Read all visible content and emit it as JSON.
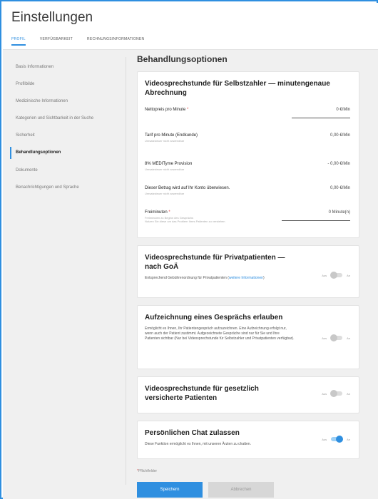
{
  "header": {
    "title": "Einstellungen",
    "tabs": [
      "PROFIL",
      "VERFÜGBARKEIT",
      "RECHNUNGSINFORMATIONEN"
    ]
  },
  "sidebar": {
    "items": [
      "Basis Informationen",
      "Profilbilde",
      "Medizinische Informationen",
      "Kategorien und Sichtbarkeit in der Suche",
      "Sicherheit",
      "Behandlungsoptionen",
      "Dokumente",
      "Benachrichtigungen und Sprache"
    ],
    "active_index": 5
  },
  "main": {
    "page_title": "Behandlungsoptionen",
    "selfpay": {
      "title": "Videosprechstunde für Selbstzahler — minutengenaue Abrechnung",
      "net_label": "Nettopreis pro Minute",
      "net_required": "*",
      "net_value": "0 €/Min",
      "tariff_label": "Tarif pro Minute (Endkunde)",
      "tariff_sub": "Umsatzsteuer nicht anwendbar",
      "tariff_value": "0,00 €/Min",
      "commission_label": "8% MEDITyme Provision",
      "commission_sub": "Umsatzsteuer nicht anwendbar",
      "commission_value": "- 0,00 €/Min",
      "payout_label": "Dieser Betrag wird auf Ihr Konto überwiesen.",
      "payout_sub": "Umsatzsteuer nicht anwendbar",
      "payout_value": "0,00 €/Min",
      "free_label": "Freiminuten",
      "free_required": "*",
      "free_sub1": "Freiminuten zu Beginn des Gesprächs",
      "free_sub2": "Nutzen Sie diese um das Problem Ihres Patienten zu verstehen",
      "free_value": "0 Minute(n)"
    },
    "private": {
      "title": "Videosprechstunde für Privatpatienten — nach GoÄ",
      "desc": "Entsprechend Gebührenordnung für Privatpatienten (",
      "link": "weitere Informationen",
      "desc_end": ")",
      "off": "Aus",
      "on": "An",
      "enabled": false
    },
    "recording": {
      "title": "Aufzeichnung eines Gesprächs erlauben",
      "desc": "Ermöglicht es Ihnen, Ihr Patientengespräch aufzuzeichnen. Eine Aufzeichnung erfolgt nur, wenn auch der Patient zustimmt. Aufgezeichnete Gespräche sind nur für Sie und Ihre Patienten sichtbar (Nur bei Videosprechstunde für Selbstzahler und Privatpatienten verfügbar).",
      "off": "Aus",
      "on": "An",
      "enabled": false
    },
    "statutory": {
      "title": "Videosprechstunde für gesetzlich versicherte Patienten",
      "off": "Aus",
      "on": "An",
      "enabled": false
    },
    "chat": {
      "title": "Persönlichen Chat zulassen",
      "desc": "Diese Funktion ermöglicht es Ihnen, mit unseren Ärzten zu chatten.",
      "off": "Aus",
      "on": "An",
      "enabled": true
    },
    "footnote": "Pflichtfelder",
    "footnote_star": "*",
    "save_label": "Speichern",
    "cancel_label": "Abbrechen"
  },
  "colors": {
    "accent": "#2f8fe0",
    "required": "#e84a4a"
  }
}
